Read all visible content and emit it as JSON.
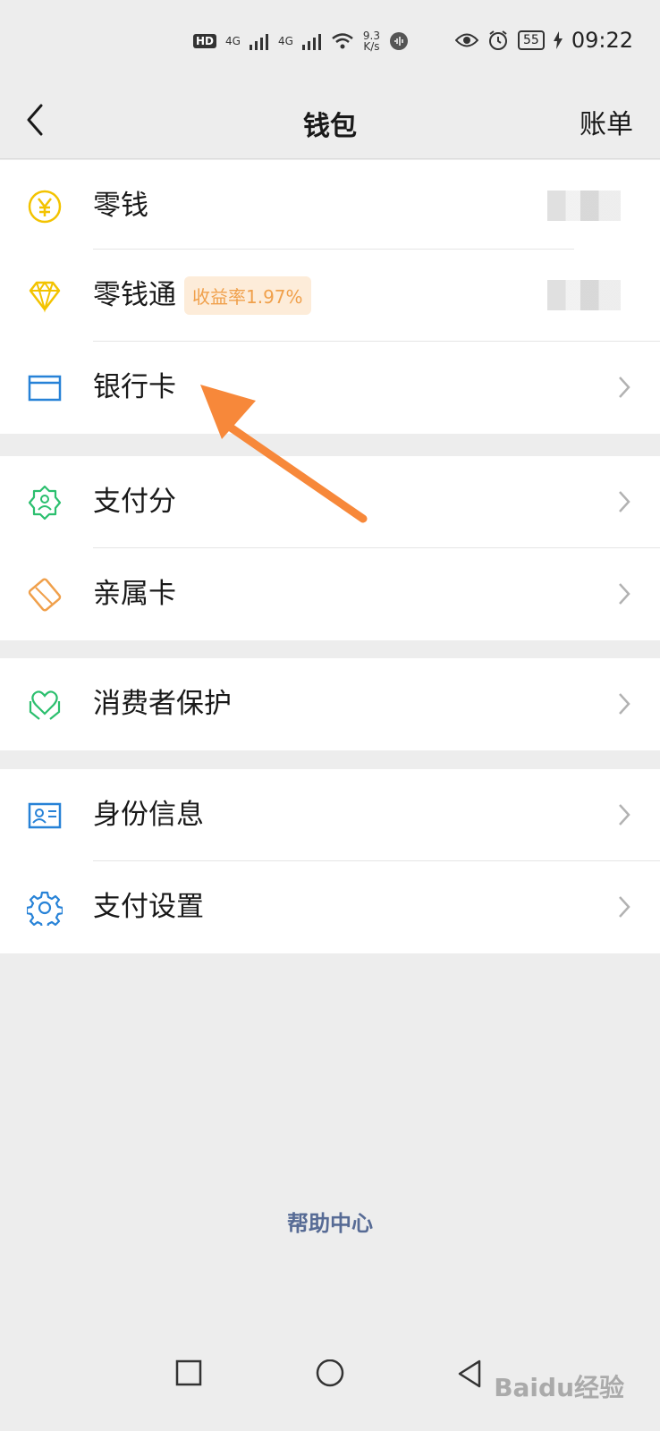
{
  "status_bar": {
    "hd": "HD",
    "net1": "4G",
    "net2": "4G",
    "speed": "9.3",
    "speed_unit": "K/s",
    "battery": "55",
    "time": "09:22"
  },
  "header": {
    "title": "钱包",
    "right_action": "账单"
  },
  "groups": [
    {
      "items": [
        {
          "label": "零钱",
          "icon": "yuan-coin-icon",
          "color": "#f3c300"
        },
        {
          "label": "零钱通",
          "icon": "diamond-icon",
          "color": "#f3c300",
          "badge": "收益率1.97%"
        },
        {
          "label": "银行卡",
          "icon": "bank-card-icon",
          "color": "#2782d7"
        }
      ]
    },
    {
      "items": [
        {
          "label": "支付分",
          "icon": "pay-score-icon",
          "color": "#2bbf6e"
        },
        {
          "label": "亲属卡",
          "icon": "family-card-icon",
          "color": "#f0a04b"
        }
      ]
    },
    {
      "items": [
        {
          "label": "消费者保护",
          "icon": "consumer-protection-icon",
          "color": "#2bbf6e"
        }
      ]
    },
    {
      "items": [
        {
          "label": "身份信息",
          "icon": "id-card-icon",
          "color": "#2782d7"
        },
        {
          "label": "支付设置",
          "icon": "gear-icon",
          "color": "#2782d7"
        }
      ]
    }
  ],
  "footer": {
    "help": "帮助中心"
  },
  "watermark": "Baidu经验",
  "colors": {
    "accent_arrow": "#f7883a",
    "link": "#576b95",
    "background": "#ededed"
  }
}
